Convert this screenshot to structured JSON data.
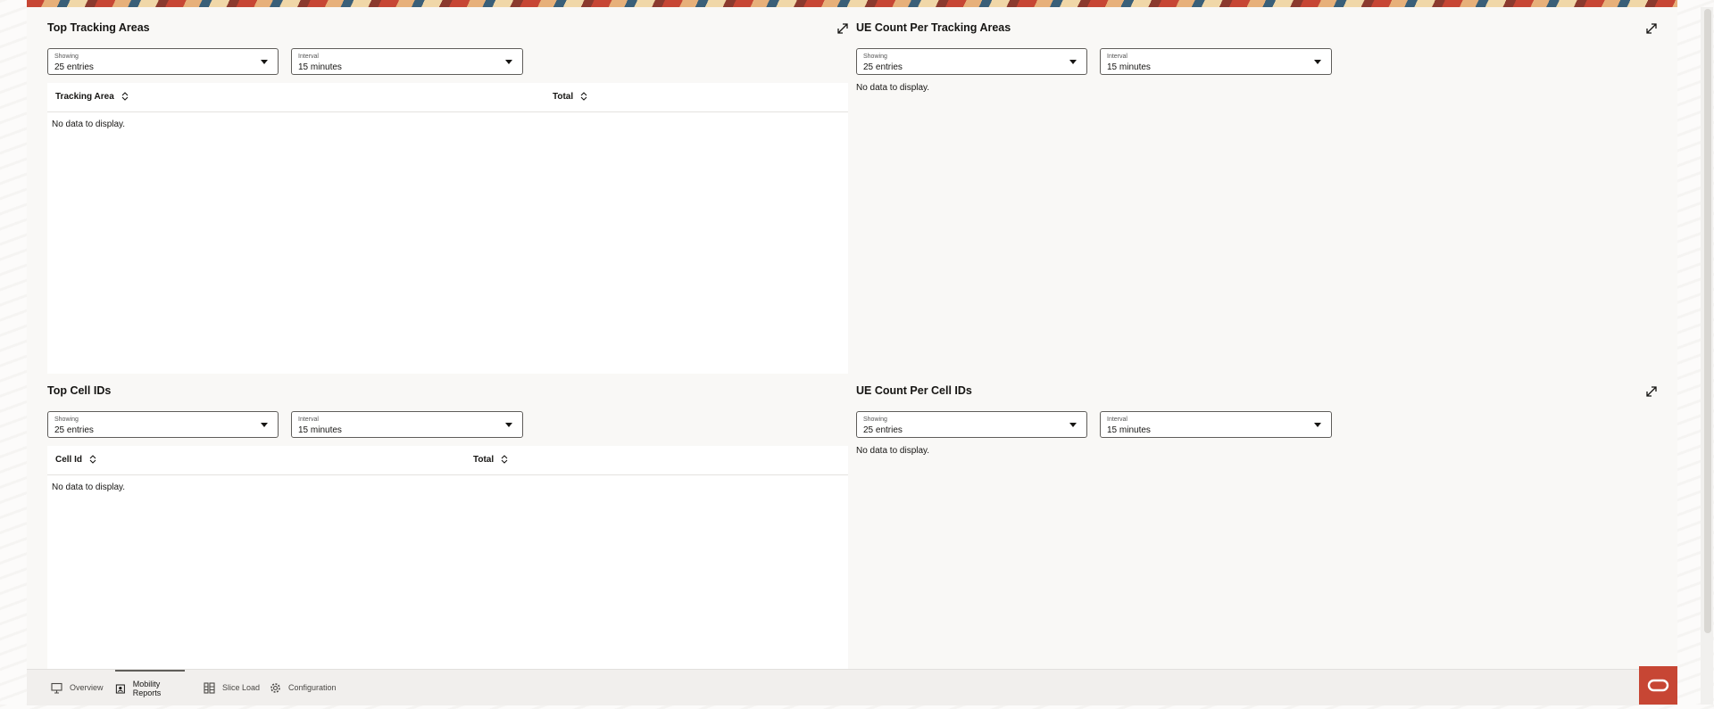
{
  "cards": {
    "top_tracking_areas": {
      "title": "Top Tracking Areas",
      "showing_label": "Showing",
      "showing_value": "25 entries",
      "interval_label": "Interval",
      "interval_value": "15 minutes",
      "columns": [
        "Tracking Area",
        "Total"
      ],
      "empty_text": "No data to display."
    },
    "ue_count_tracking_areas": {
      "title": "UE Count Per Tracking Areas",
      "showing_label": "Showing",
      "showing_value": "25 entries",
      "interval_label": "Interval",
      "interval_value": "15 minutes",
      "empty_text": "No data to display."
    },
    "top_cell_ids": {
      "title": "Top Cell IDs",
      "showing_label": "Showing",
      "showing_value": "25 entries",
      "interval_label": "Interval",
      "interval_value": "15 minutes",
      "columns": [
        "Cell Id",
        "Total"
      ],
      "empty_text": "No data to display."
    },
    "ue_count_cell_ids": {
      "title": "UE Count Per Cell IDs",
      "showing_label": "Showing",
      "showing_value": "25 entries",
      "interval_label": "Interval",
      "interval_value": "15 minutes",
      "empty_text": "No data to display."
    }
  },
  "footer_nav": {
    "items": [
      {
        "label": "Overview",
        "icon": "monitor-icon"
      },
      {
        "label": "Mobility Reports",
        "icon": "report-icon"
      },
      {
        "label": "Slice Load",
        "icon": "grid-icon"
      },
      {
        "label": "Configuration",
        "icon": "gear-icon"
      }
    ],
    "active": "Mobility Reports"
  },
  "colors": {
    "brand_red": "#c74634",
    "panel_bg": "#f9f8f6",
    "text": "#161513"
  }
}
